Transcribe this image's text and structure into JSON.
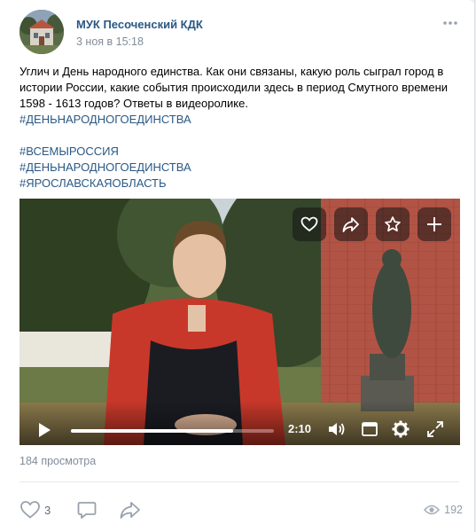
{
  "post": {
    "author": "МУК Песоченский КДК",
    "date": "3 ноя в 15:18",
    "text_lines": [
      "Углич и День народного единства. Как они связаны, какую роль сыграл город в",
      "истории России, какие события происходили здесь в период Смутного времени",
      "1598 - 1613 годов? Ответы в видеоролике."
    ],
    "hashtags_inline": "#ДЕНЬНАРОДНОГОЕДИНСТВА",
    "hashtags": [
      "#ВСЕМЫРОССИЯ",
      "#ДЕНЬНАРОДНОГОЕДИНСТВА",
      "#ЯРОСЛАВСКАЯОБЛАСТЬ"
    ]
  },
  "video": {
    "time": "2:10",
    "progress": 0.8,
    "overlay_buttons": [
      "heart-icon",
      "share-icon",
      "star-icon",
      "plus-icon"
    ],
    "control_icons": [
      "play-icon",
      "volume-icon",
      "miniplayer-icon",
      "settings-icon",
      "fullscreen-icon"
    ]
  },
  "views_text": "184 просмотра",
  "actions": {
    "likes": "3",
    "views_count": "192"
  },
  "colors": {
    "link": "#2a5885",
    "muted": "#818c99",
    "background": "#edeef0"
  }
}
